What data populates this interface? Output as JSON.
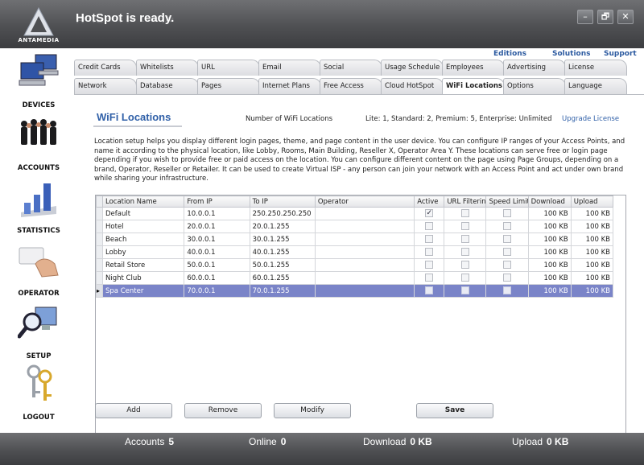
{
  "app": {
    "brand": "ANTAMEDIA",
    "status_title": "HotSpot is ready.",
    "window_controls": {
      "minimize": "–",
      "restore": "🗗",
      "close": "✕"
    }
  },
  "sidebar": {
    "items": [
      {
        "label": "DEVICES",
        "icon": "computers-icon"
      },
      {
        "label": "ACCOUNTS",
        "icon": "people-icon"
      },
      {
        "label": "STATISTICS",
        "icon": "bar-chart-icon"
      },
      {
        "label": "OPERATOR",
        "icon": "hand-card-icon"
      },
      {
        "label": "SETUP",
        "icon": "magnifier-monitor-icon"
      },
      {
        "label": "LOGOUT",
        "icon": "keys-icon"
      }
    ]
  },
  "toplinks": {
    "editions": "Editions",
    "solutions": "Solutions",
    "support": "Support"
  },
  "tabs": {
    "row1": [
      "Credit Cards",
      "Whitelists",
      "URL",
      "Email",
      "Social",
      "Usage Schedule",
      "Employees",
      "Advertising",
      "License"
    ],
    "row2": [
      "Network",
      "Database",
      "Pages",
      "Internet Plans",
      "Free Access",
      "Cloud HotSpot",
      "WiFi Locations",
      "Options",
      "Language"
    ],
    "active": "WiFi Locations"
  },
  "page": {
    "title": "WiFi Locations",
    "count_label": "Number of WiFi Locations",
    "license_info": "Lite: 1, Standard: 2, Premium: 5, Enterprise: Unlimited",
    "upgrade_link": "Upgrade License",
    "description": "Location setup helps you display different login pages, theme, and page content in the user device. You can configure IP ranges of your Access Points, and name it according to the physical location, like Lobby, Rooms, Main Building, Reseller X, Operator Area Y. These locations can serve free or login page depending if you wish to provide free or paid access on the location. You can configure different content on the page using Page Groups, depending on a brand, Operator, Reseller or Retailer. It can be used to create Virtual ISP - any person can join your network with an Access Point and act under own brand while sharing your infrastructure."
  },
  "grid": {
    "columns": [
      "Location Name",
      "From IP",
      "To IP",
      "Operator",
      "Active",
      "URL Filtering",
      "Speed Limit",
      "Download",
      "Upload"
    ],
    "rows": [
      {
        "name": "Default",
        "from": "10.0.0.1",
        "to": "250.250.250.250",
        "operator": "",
        "active": true,
        "url_filtering": false,
        "speed_limit": false,
        "download": "100 KB",
        "upload": "100 KB"
      },
      {
        "name": "Hotel",
        "from": "20.0.0.1",
        "to": "20.0.1.255",
        "operator": "",
        "active": false,
        "url_filtering": false,
        "speed_limit": false,
        "download": "100 KB",
        "upload": "100 KB"
      },
      {
        "name": "Beach",
        "from": "30.0.0.1",
        "to": "30.0.1.255",
        "operator": "",
        "active": false,
        "url_filtering": false,
        "speed_limit": false,
        "download": "100 KB",
        "upload": "100 KB"
      },
      {
        "name": "Lobby",
        "from": "40.0.0.1",
        "to": "40.0.1.255",
        "operator": "",
        "active": false,
        "url_filtering": false,
        "speed_limit": false,
        "download": "100 KB",
        "upload": "100 KB"
      },
      {
        "name": "Retail Store",
        "from": "50.0.0.1",
        "to": "50.0.1.255",
        "operator": "",
        "active": false,
        "url_filtering": false,
        "speed_limit": false,
        "download": "100 KB",
        "upload": "100 KB"
      },
      {
        "name": "Night Club",
        "from": "60.0.0.1",
        "to": "60.0.1.255",
        "operator": "",
        "active": false,
        "url_filtering": false,
        "speed_limit": false,
        "download": "100 KB",
        "upload": "100 KB"
      },
      {
        "name": "Spa Center",
        "from": "70.0.0.1",
        "to": "70.0.1.255",
        "operator": "",
        "active": false,
        "url_filtering": false,
        "speed_limit": false,
        "download": "100 KB",
        "upload": "100 KB",
        "selected": true
      }
    ]
  },
  "buttons": {
    "add": "Add",
    "remove": "Remove",
    "modify": "Modify",
    "save": "Save"
  },
  "footer": {
    "accounts_label": "Accounts",
    "accounts_value": "5",
    "online_label": "Online",
    "online_value": "0",
    "download_label": "Download",
    "download_value": "0 KB",
    "upload_label": "Upload",
    "upload_value": "0 KB"
  },
  "colors": {
    "accent": "#3060a8",
    "selection": "#7a84c8",
    "chrome": "#4f5053"
  }
}
